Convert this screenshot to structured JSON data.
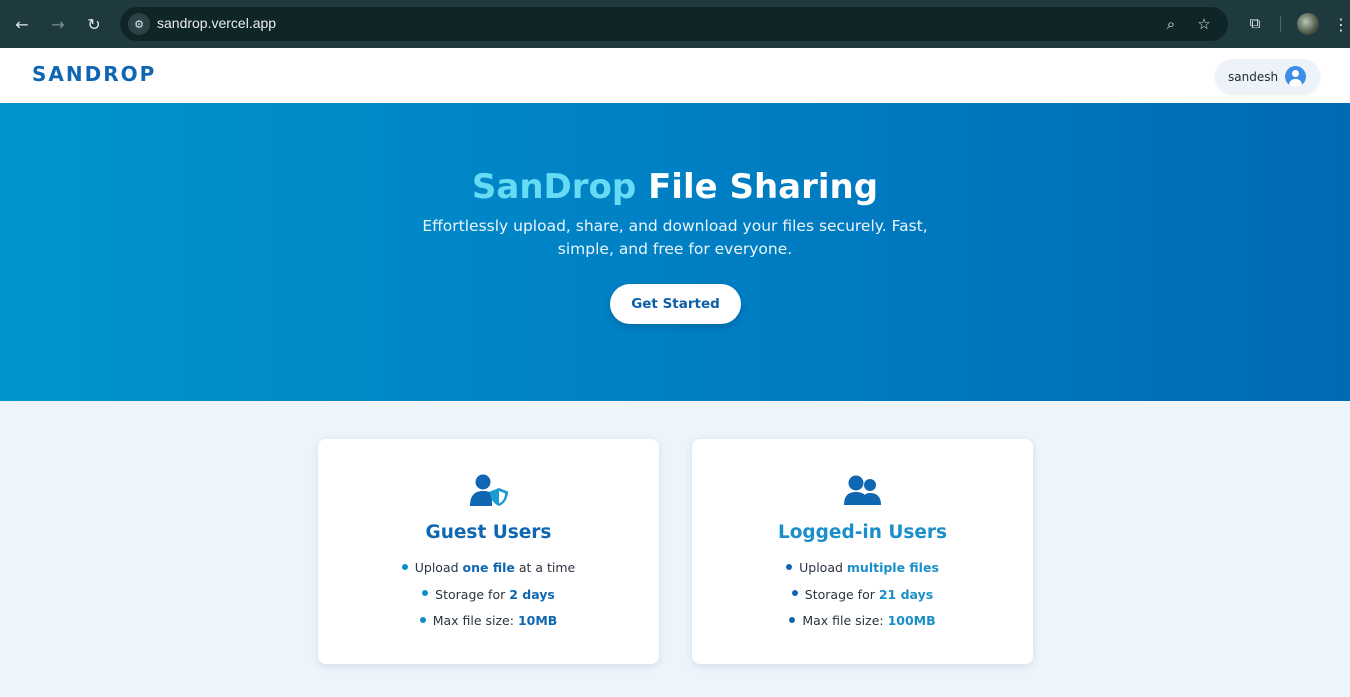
{
  "browser": {
    "url": "sandrop.vercel.app",
    "back_icon": "arrow-left",
    "forward_icon": "arrow-right",
    "reload_icon": "reload",
    "site_info_icon": "tune",
    "zoom_icon": "magnifier",
    "bookmark_icon": "star",
    "extensions_icon": "puzzle",
    "menu_icon": "vertical-dots"
  },
  "header": {
    "brand": "SANDROP",
    "username": "sandesh"
  },
  "hero": {
    "title_accent": "SanDrop",
    "title_rest": "File Sharing",
    "subtitle": "Effortlessly upload, share, and download your files securely. Fast, simple, and free for everyone.",
    "cta_label": "Get Started"
  },
  "cards": [
    {
      "title": "Guest Users",
      "icon": "user-shield",
      "features": [
        {
          "pre": "Upload ",
          "highlight": "one file",
          "post": " at a time"
        },
        {
          "pre": "Storage for ",
          "highlight": "2 days",
          "post": ""
        },
        {
          "pre": "Max file size: ",
          "highlight": "10MB",
          "post": ""
        }
      ]
    },
    {
      "title": "Logged-in Users",
      "icon": "users",
      "features": [
        {
          "pre": "Upload ",
          "highlight": "multiple files",
          "post": ""
        },
        {
          "pre": "Storage for ",
          "highlight": "21 days",
          "post": ""
        },
        {
          "pre": "Max file size: ",
          "highlight": "100MB",
          "post": ""
        }
      ]
    }
  ],
  "colors": {
    "brand": "#0f67b2",
    "hero_start": "#0095cd",
    "hero_end": "#006ab5",
    "accent": "#66dbf4"
  }
}
